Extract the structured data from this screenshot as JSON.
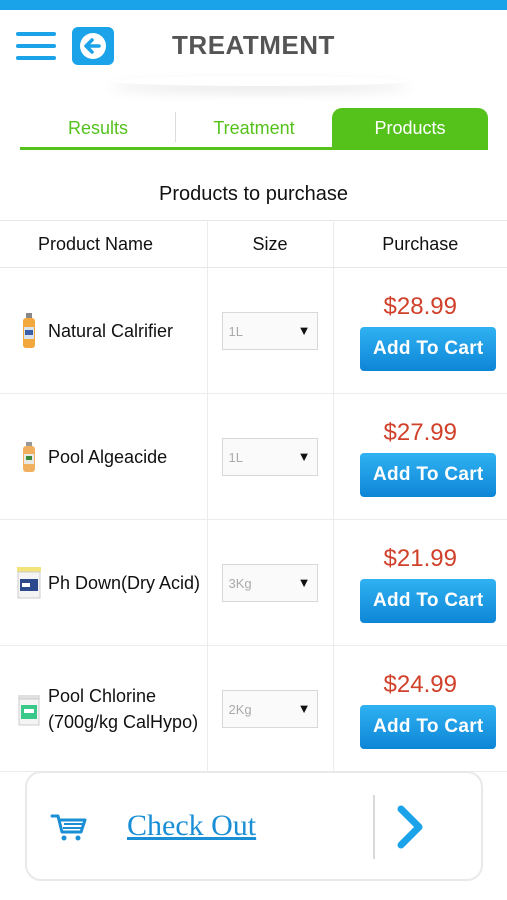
{
  "header": {
    "title": "TREATMENT",
    "menu_icon": "hamburger-menu-icon",
    "back_icon": "arrow-left-icon",
    "accent_color": "#1aa3e8"
  },
  "tabs": [
    {
      "label": "Results",
      "active": false
    },
    {
      "label": "Treatment",
      "active": false
    },
    {
      "label": "Products",
      "active": true
    }
  ],
  "tab_color": "#55c21c",
  "section_title": "Products to purchase",
  "table": {
    "headers": {
      "name": "Product Name",
      "size": "Size",
      "purchase": "Purchase"
    },
    "rows": [
      {
        "name": "Natural Calrifier",
        "size": "1L",
        "price": "$28.99",
        "button": "Add To Cart",
        "icon": "bottle-icon"
      },
      {
        "name": "Pool Algeacide",
        "size": "1L",
        "price": "$27.99",
        "button": "Add To Cart",
        "icon": "bottle-icon"
      },
      {
        "name": "Ph Down(Dry Acid)",
        "size": "3Kg",
        "price": "$21.99",
        "button": "Add To Cart",
        "icon": "tub-icon"
      },
      {
        "name": "Pool Chlorine (700g/kg CalHypo)",
        "size": "2Kg",
        "price": "$24.99",
        "button": "Add To Cart",
        "icon": "bucket-icon"
      }
    ]
  },
  "price_color": "#d0402a",
  "checkout": {
    "label": "Check Out",
    "icon": "shopping-cart-icon",
    "arrow_icon": "chevron-right-icon"
  }
}
